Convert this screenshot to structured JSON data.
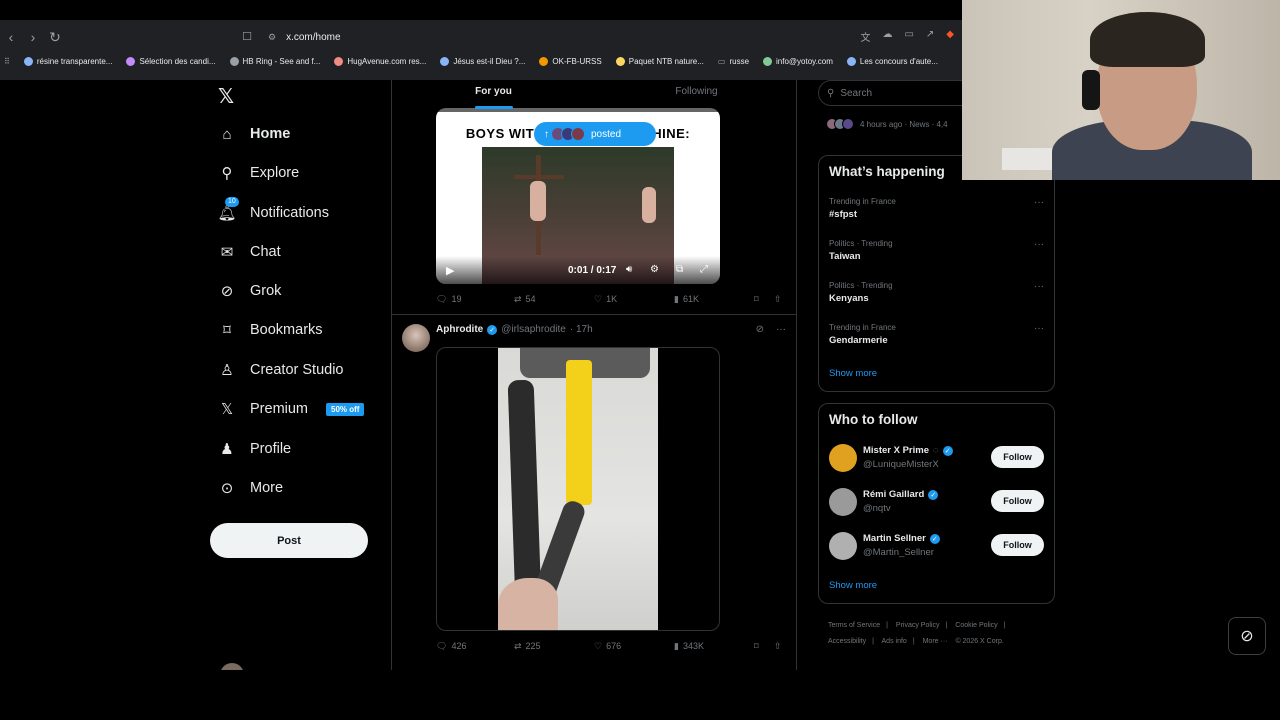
{
  "browser": {
    "url": "x.com/home",
    "bookmarks": [
      "résine transparente...",
      "Sélection des candi...",
      "HB Ring - See and f...",
      "HugAvenue.com res...",
      "Jésus est-il Dieu ?...",
      "OK-FB-URSS",
      "Paquet NTB nature...",
      "russe",
      "info@yotoy.com",
      "Les concours d'aute..."
    ]
  },
  "nav": {
    "items": [
      {
        "label": "Home",
        "icon": "home-icon"
      },
      {
        "label": "Explore",
        "icon": "search-icon"
      },
      {
        "label": "Notifications",
        "icon": "bell-icon"
      },
      {
        "label": "Chat",
        "icon": "mail-icon"
      },
      {
        "label": "Grok",
        "icon": "grok-icon"
      },
      {
        "label": "Bookmarks",
        "icon": "bookmark-icon"
      },
      {
        "label": "Creator Studio",
        "icon": "creator-icon"
      },
      {
        "label": "Premium",
        "icon": "x-icon"
      },
      {
        "label": "Profile",
        "icon": "person-icon"
      },
      {
        "label": "More",
        "icon": "more-icon"
      }
    ],
    "notif_count": "10",
    "premium_badge": "50% off",
    "post_label": "Post"
  },
  "feed": {
    "tabs": [
      "For you",
      "Following"
    ],
    "tweet1": {
      "caption": "BOYS WIT",
      "caption_end": "HINE:",
      "posted_label": "posted",
      "time": "0:01 / 0:17",
      "replies": "19",
      "reposts": "54",
      "likes": "1K",
      "views": "61K"
    },
    "tweet2": {
      "name": "Aphrodite",
      "handle": "@irlsaphrodite",
      "time": "· 17h",
      "replies": "426",
      "reposts": "225",
      "likes": "676",
      "views": "343K"
    }
  },
  "sidebar": {
    "search_placeholder": "Search",
    "news_meta": "4 hours ago · News · 4,4",
    "whats_happening": {
      "title": "What’s happening",
      "trends": [
        {
          "meta": "Trending in France",
          "title": "#sfpst"
        },
        {
          "meta": "Politics · Trending",
          "title": "Taiwan"
        },
        {
          "meta": "Politics · Trending",
          "title": "Kenyans"
        },
        {
          "meta": "Trending in France",
          "title": "Gendarmerie"
        }
      ],
      "show_more": "Show more"
    },
    "who_to_follow": {
      "title": "Who to follow",
      "users": [
        {
          "name": "Mister X Prime",
          "handle": "@LuniqueMisterX",
          "color": "#e0a020"
        },
        {
          "name": "Rémi Gaillard",
          "handle": "@nqtv",
          "color": "#9a9a9a"
        },
        {
          "name": "Martin Sellner",
          "handle": "@Martin_Sellner",
          "color": "#b0b0b0"
        }
      ],
      "follow_label": "Follow",
      "show_more": "Show more"
    },
    "footer": [
      "Terms of Service",
      "|",
      "Privacy Policy",
      "|",
      "Cookie Policy",
      "|",
      "Accessibility",
      "|",
      "Ads info",
      "|",
      "More ···",
      "© 2026 X Corp."
    ]
  },
  "accent": "#1d9bf0"
}
